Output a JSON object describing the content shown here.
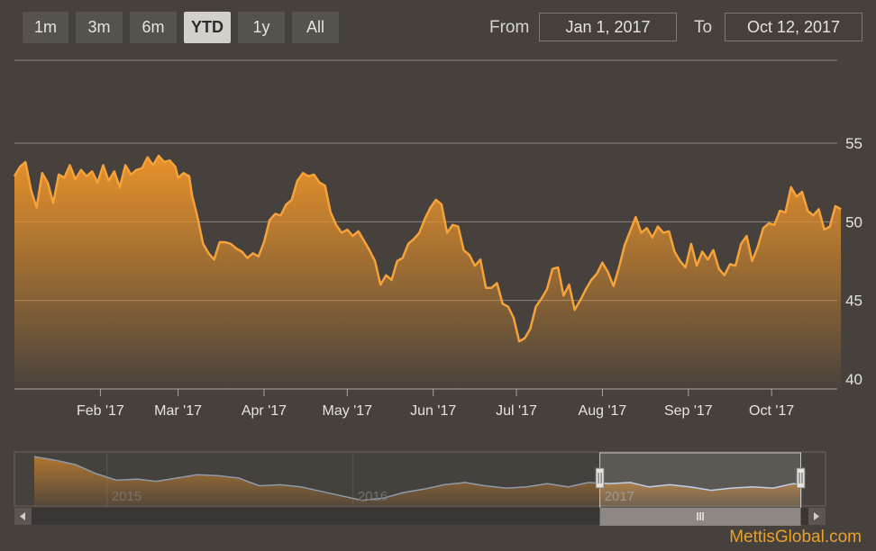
{
  "range_selector": {
    "buttons": [
      {
        "label": "1m",
        "active": false
      },
      {
        "label": "3m",
        "active": false
      },
      {
        "label": "6m",
        "active": false
      },
      {
        "label": "YTD",
        "active": true
      },
      {
        "label": "1y",
        "active": false
      },
      {
        "label": "All",
        "active": false
      }
    ],
    "from_label": "From",
    "from_value": "Jan 1, 2017",
    "to_label": "To",
    "to_value": "Oct 12, 2017"
  },
  "colors": {
    "line": "#f5a23a",
    "fill_top": "#e8922a",
    "navigator_line": "#b7c9e6",
    "background": "#46413d"
  },
  "chart_data": {
    "type": "area",
    "title": "",
    "xlabel": "",
    "ylabel": "",
    "ylim": [
      40,
      55
    ],
    "yticks": [
      40,
      45,
      50,
      55
    ],
    "grid": "horizontal",
    "x_ticks": [
      "Feb '17",
      "Mar '17",
      "Apr '17",
      "May '17",
      "Jun '17",
      "Jul '17",
      "Aug '17",
      "Sep '17",
      "Oct '17"
    ],
    "xlim": [
      "2017-01-01",
      "2017-10-12"
    ],
    "series": [
      {
        "points": [
          [
            "2017-01-01",
            52.9
          ],
          [
            "2017-01-03",
            53.5
          ],
          [
            "2017-01-05",
            53.8
          ],
          [
            "2017-01-07",
            52.0
          ],
          [
            "2017-01-09",
            50.9
          ],
          [
            "2017-01-11",
            53.1
          ],
          [
            "2017-01-13",
            52.5
          ],
          [
            "2017-01-15",
            51.2
          ],
          [
            "2017-01-17",
            53.0
          ],
          [
            "2017-01-19",
            52.8
          ],
          [
            "2017-01-21",
            53.6
          ],
          [
            "2017-01-23",
            52.7
          ],
          [
            "2017-01-25",
            53.3
          ],
          [
            "2017-01-27",
            52.9
          ],
          [
            "2017-01-29",
            53.2
          ],
          [
            "2017-01-31",
            52.5
          ],
          [
            "2017-02-02",
            53.6
          ],
          [
            "2017-02-04",
            52.6
          ],
          [
            "2017-02-06",
            53.2
          ],
          [
            "2017-02-08",
            52.2
          ],
          [
            "2017-02-10",
            53.6
          ],
          [
            "2017-02-12",
            53.0
          ],
          [
            "2017-02-14",
            53.3
          ],
          [
            "2017-02-16",
            53.4
          ],
          [
            "2017-02-18",
            54.1
          ],
          [
            "2017-02-20",
            53.6
          ],
          [
            "2017-02-22",
            54.2
          ],
          [
            "2017-02-24",
            53.8
          ],
          [
            "2017-02-26",
            53.9
          ],
          [
            "2017-02-28",
            53.5
          ],
          [
            "2017-03-01",
            52.8
          ],
          [
            "2017-03-03",
            53.1
          ],
          [
            "2017-03-05",
            52.9
          ],
          [
            "2017-03-06",
            51.7
          ],
          [
            "2017-03-08",
            50.3
          ],
          [
            "2017-03-10",
            48.6
          ],
          [
            "2017-03-12",
            48.0
          ],
          [
            "2017-03-14",
            47.6
          ],
          [
            "2017-03-16",
            48.7
          ],
          [
            "2017-03-18",
            48.7
          ],
          [
            "2017-03-20",
            48.6
          ],
          [
            "2017-03-22",
            48.3
          ],
          [
            "2017-03-24",
            48.1
          ],
          [
            "2017-03-26",
            47.7
          ],
          [
            "2017-03-28",
            48.0
          ],
          [
            "2017-03-30",
            47.8
          ],
          [
            "2017-04-01",
            48.7
          ],
          [
            "2017-04-03",
            50.1
          ],
          [
            "2017-04-05",
            50.5
          ],
          [
            "2017-04-07",
            50.4
          ],
          [
            "2017-04-09",
            51.1
          ],
          [
            "2017-04-11",
            51.4
          ],
          [
            "2017-04-13",
            52.6
          ],
          [
            "2017-04-15",
            53.1
          ],
          [
            "2017-04-17",
            52.9
          ],
          [
            "2017-04-19",
            53.0
          ],
          [
            "2017-04-21",
            52.5
          ],
          [
            "2017-04-23",
            52.3
          ],
          [
            "2017-04-25",
            50.6
          ],
          [
            "2017-04-27",
            49.8
          ],
          [
            "2017-04-29",
            49.3
          ],
          [
            "2017-05-01",
            49.5
          ],
          [
            "2017-05-03",
            49.1
          ],
          [
            "2017-05-05",
            49.4
          ],
          [
            "2017-05-07",
            48.8
          ],
          [
            "2017-05-09",
            48.2
          ],
          [
            "2017-05-11",
            47.5
          ],
          [
            "2017-05-13",
            46.0
          ],
          [
            "2017-05-15",
            46.6
          ],
          [
            "2017-05-17",
            46.3
          ],
          [
            "2017-05-19",
            47.5
          ],
          [
            "2017-05-21",
            47.7
          ],
          [
            "2017-05-23",
            48.6
          ],
          [
            "2017-05-25",
            48.9
          ],
          [
            "2017-05-27",
            49.3
          ],
          [
            "2017-05-29",
            50.2
          ],
          [
            "2017-05-31",
            50.9
          ],
          [
            "2017-06-02",
            51.4
          ],
          [
            "2017-06-04",
            51.1
          ],
          [
            "2017-06-06",
            49.3
          ],
          [
            "2017-06-08",
            49.8
          ],
          [
            "2017-06-10",
            49.7
          ],
          [
            "2017-06-12",
            48.2
          ],
          [
            "2017-06-14",
            47.9
          ],
          [
            "2017-06-16",
            47.2
          ],
          [
            "2017-06-18",
            47.6
          ],
          [
            "2017-06-20",
            45.8
          ],
          [
            "2017-06-22",
            45.8
          ],
          [
            "2017-06-24",
            46.1
          ],
          [
            "2017-06-26",
            44.8
          ],
          [
            "2017-06-28",
            44.6
          ],
          [
            "2017-06-30",
            43.9
          ],
          [
            "2017-07-02",
            42.4
          ],
          [
            "2017-07-04",
            42.6
          ],
          [
            "2017-07-06",
            43.2
          ],
          [
            "2017-07-08",
            44.6
          ],
          [
            "2017-07-10",
            45.1
          ],
          [
            "2017-07-12",
            45.7
          ],
          [
            "2017-07-14",
            47.0
          ],
          [
            "2017-07-16",
            47.1
          ],
          [
            "2017-07-18",
            45.3
          ],
          [
            "2017-07-20",
            46.0
          ],
          [
            "2017-07-22",
            44.4
          ],
          [
            "2017-07-24",
            45.0
          ],
          [
            "2017-07-26",
            45.7
          ],
          [
            "2017-07-28",
            46.3
          ],
          [
            "2017-07-30",
            46.7
          ],
          [
            "2017-08-01",
            47.4
          ],
          [
            "2017-08-03",
            46.8
          ],
          [
            "2017-08-05",
            45.9
          ],
          [
            "2017-08-07",
            47.1
          ],
          [
            "2017-08-09",
            48.5
          ],
          [
            "2017-08-11",
            49.4
          ],
          [
            "2017-08-13",
            50.3
          ],
          [
            "2017-08-15",
            49.3
          ],
          [
            "2017-08-17",
            49.6
          ],
          [
            "2017-08-19",
            49.0
          ],
          [
            "2017-08-21",
            49.7
          ],
          [
            "2017-08-23",
            49.3
          ],
          [
            "2017-08-25",
            49.4
          ],
          [
            "2017-08-27",
            48.1
          ],
          [
            "2017-08-29",
            47.5
          ],
          [
            "2017-08-31",
            47.1
          ],
          [
            "2017-09-02",
            48.6
          ],
          [
            "2017-09-04",
            47.2
          ],
          [
            "2017-09-06",
            48.1
          ],
          [
            "2017-09-08",
            47.6
          ],
          [
            "2017-09-10",
            48.2
          ],
          [
            "2017-09-12",
            47.0
          ],
          [
            "2017-09-14",
            46.6
          ],
          [
            "2017-09-16",
            47.3
          ],
          [
            "2017-09-18",
            47.2
          ],
          [
            "2017-09-20",
            48.6
          ],
          [
            "2017-09-22",
            49.1
          ],
          [
            "2017-09-24",
            47.5
          ],
          [
            "2017-09-26",
            48.4
          ],
          [
            "2017-09-28",
            49.6
          ],
          [
            "2017-09-30",
            49.9
          ],
          [
            "2017-10-02",
            49.8
          ],
          [
            "2017-10-04",
            50.7
          ],
          [
            "2017-10-06",
            50.6
          ],
          [
            "2017-10-08",
            52.2
          ],
          [
            "2017-10-10",
            51.6
          ],
          [
            "2017-10-12",
            51.9
          ],
          [
            "2017-10-14",
            50.7
          ],
          [
            "2017-10-16",
            50.4
          ],
          [
            "2017-10-18",
            50.8
          ],
          [
            "2017-10-20",
            49.5
          ],
          [
            "2017-10-22",
            49.7
          ],
          [
            "2017-10-24",
            51.0
          ],
          [
            "2017-10-26",
            50.8
          ]
        ]
      }
    ]
  },
  "navigator": {
    "year_labels": [
      "2015",
      "2016",
      "2017"
    ],
    "xlim": [
      "2014-09-15",
      "2017-10-28"
    ],
    "years": [
      "2015-01-01",
      "2016-01-01",
      "2017-01-01"
    ],
    "selection": [
      "2017-01-01",
      "2017-10-26"
    ],
    "ylim": [
      35,
      80
    ],
    "points": [
      [
        "2014-09-15",
        79
      ],
      [
        "2014-10-15",
        76
      ],
      [
        "2014-11-15",
        72
      ],
      [
        "2014-12-15",
        64
      ],
      [
        "2015-01-15",
        58
      ],
      [
        "2015-02-15",
        59
      ],
      [
        "2015-03-15",
        57
      ],
      [
        "2015-04-15",
        60
      ],
      [
        "2015-05-15",
        63
      ],
      [
        "2015-06-15",
        62
      ],
      [
        "2015-07-15",
        60
      ],
      [
        "2015-08-15",
        53
      ],
      [
        "2015-09-15",
        54
      ],
      [
        "2015-10-15",
        52
      ],
      [
        "2015-11-15",
        48
      ],
      [
        "2015-12-15",
        44
      ],
      [
        "2016-01-15",
        40
      ],
      [
        "2016-02-15",
        42
      ],
      [
        "2016-03-15",
        47
      ],
      [
        "2016-04-15",
        50
      ],
      [
        "2016-05-15",
        54
      ],
      [
        "2016-06-15",
        56
      ],
      [
        "2016-07-15",
        53
      ],
      [
        "2016-08-15",
        51
      ],
      [
        "2016-09-15",
        52
      ],
      [
        "2016-10-15",
        55
      ],
      [
        "2016-11-15",
        52
      ],
      [
        "2016-12-15",
        56
      ],
      [
        "2017-01-15",
        55
      ],
      [
        "2017-02-15",
        56
      ],
      [
        "2017-03-15",
        52
      ],
      [
        "2017-04-15",
        54
      ],
      [
        "2017-05-15",
        52
      ],
      [
        "2017-06-15",
        49
      ],
      [
        "2017-07-15",
        51
      ],
      [
        "2017-08-15",
        52
      ],
      [
        "2017-09-15",
        51
      ],
      [
        "2017-10-15",
        55
      ],
      [
        "2017-10-28",
        54
      ]
    ]
  },
  "watermark": "MettisGlobal.com"
}
